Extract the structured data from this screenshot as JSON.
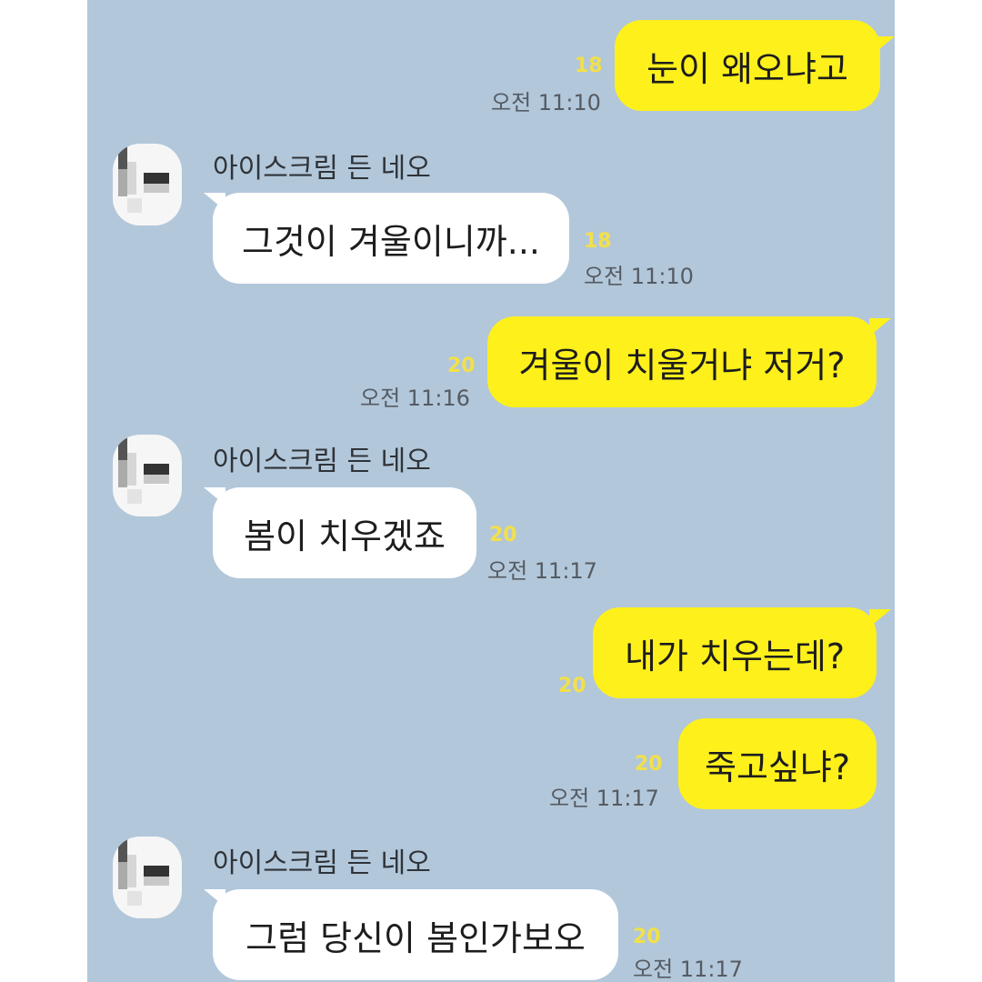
{
  "chat": {
    "background_color": "#b2c7da",
    "my_bubble_color": "#fef01b",
    "other_bubble_color": "#ffffff",
    "messages": [
      {
        "from": "me",
        "text": "눈이 왜오냐고",
        "unread": "18",
        "time": "오전 11:10"
      },
      {
        "from": "other",
        "sender": "아이스크림 든 네오",
        "text": "그것이 겨울이니까...",
        "unread": "18",
        "time": "오전 11:10"
      },
      {
        "from": "me",
        "text": "겨울이 치울거냐 저거?",
        "unread": "20",
        "time": "오전 11:16"
      },
      {
        "from": "other",
        "sender": "아이스크림 든 네오",
        "text": "봄이 치우겠죠",
        "unread": "20",
        "time": "오전 11:17"
      },
      {
        "from": "me",
        "text": "내가 치우는데?",
        "unread": "20",
        "time": ""
      },
      {
        "from": "me",
        "text": "죽고싶냐?",
        "unread": "20",
        "time": "오전 11:17"
      },
      {
        "from": "other",
        "sender": "아이스크림 든 네오",
        "text": "그럼 당신이 봄인가보오",
        "unread": "20",
        "time": "오전 11:17"
      }
    ]
  }
}
